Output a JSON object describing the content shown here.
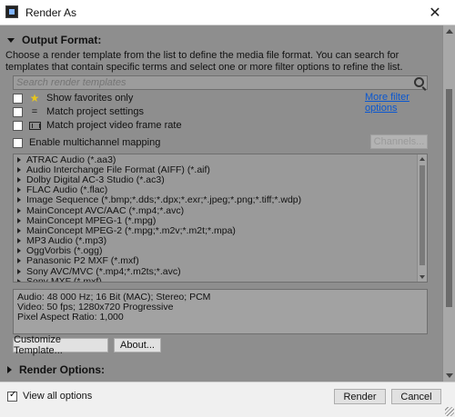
{
  "window": {
    "title": "Render As",
    "close_glyph": "✕"
  },
  "output_format": {
    "header": "Output Format:",
    "description": "Choose a render template from the list to define the media file format. You can search for templates that contain specific terms and select one or more filter options to refine the list.",
    "search_placeholder": "Search render templates",
    "more_filter_options": "More filter options",
    "options": [
      {
        "label": "Show favorites only",
        "icon": "star-icon",
        "checked": false
      },
      {
        "label": "Match project settings",
        "icon": "equals-icon",
        "checked": false
      },
      {
        "label": "Match project video frame rate",
        "icon": "film-icon",
        "checked": false
      },
      {
        "label": "Enable multichannel mapping",
        "icon": "",
        "checked": false
      }
    ],
    "channels_button": "Channels...",
    "templates": [
      "ATRAC Audio (*.aa3)",
      "Audio Interchange File Format (AIFF) (*.aif)",
      "Dolby Digital AC-3 Studio (*.ac3)",
      "FLAC Audio (*.flac)",
      "Image Sequence (*.bmp;*.dds;*.dpx;*.exr;*.jpeg;*.png;*.tiff;*.wdp)",
      "MainConcept AVC/AAC (*.mp4;*.avc)",
      "MainConcept MPEG-1 (*.mpg)",
      "MainConcept MPEG-2 (*.mpg;*.m2v;*.m2t;*.mpa)",
      "MP3 Audio (*.mp3)",
      "OggVorbis (*.ogg)",
      "Panasonic P2 MXF (*.mxf)",
      "Sony AVC/MVC (*.mp4;*.m2ts;*.avc)",
      "Sony MXF (*.mxf)"
    ],
    "info_lines": [
      "Audio: 48 000 Hz; 16 Bit (MAC); Stereo; PCM",
      "Video: 50 fps; 1280x720 Progressive",
      "Pixel Aspect Ratio: 1,000"
    ],
    "customize_button": "Customize Template...",
    "about_button": "About..."
  },
  "render_options": {
    "header": "Render Options:"
  },
  "footer": {
    "view_all_label": "View all options",
    "view_all_checked": true,
    "render_button": "Render",
    "cancel_button": "Cancel"
  },
  "colors": {
    "panel": "#8e8e8e",
    "link": "#0a57d0",
    "star": "#e8c61a"
  }
}
